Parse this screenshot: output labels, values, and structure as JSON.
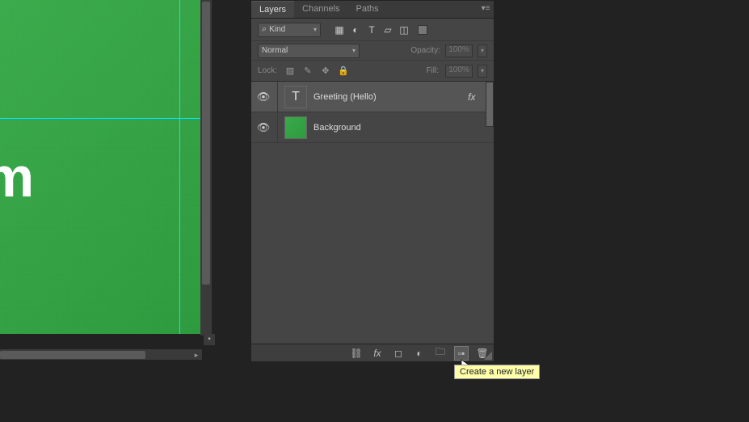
{
  "canvas": {
    "text_top": "!",
    "text_bottom": "m"
  },
  "panel": {
    "tabs": [
      "Layers",
      "Channels",
      "Paths"
    ],
    "active_tab": 0,
    "kind_label": "Kind",
    "blend_mode": "Normal",
    "opacity_label": "Opacity:",
    "opacity_value": "100%",
    "lock_label": "Lock:",
    "fill_label": "Fill:",
    "fill_value": "100%",
    "layers": [
      {
        "name": "Greeting (Hello)",
        "type": "text",
        "visible": true,
        "fx": true,
        "selected": true
      },
      {
        "name": "Background",
        "type": "raster",
        "visible": true,
        "fx": false,
        "selected": false
      }
    ],
    "fx_label": "fx"
  },
  "tooltip": "Create a new layer"
}
